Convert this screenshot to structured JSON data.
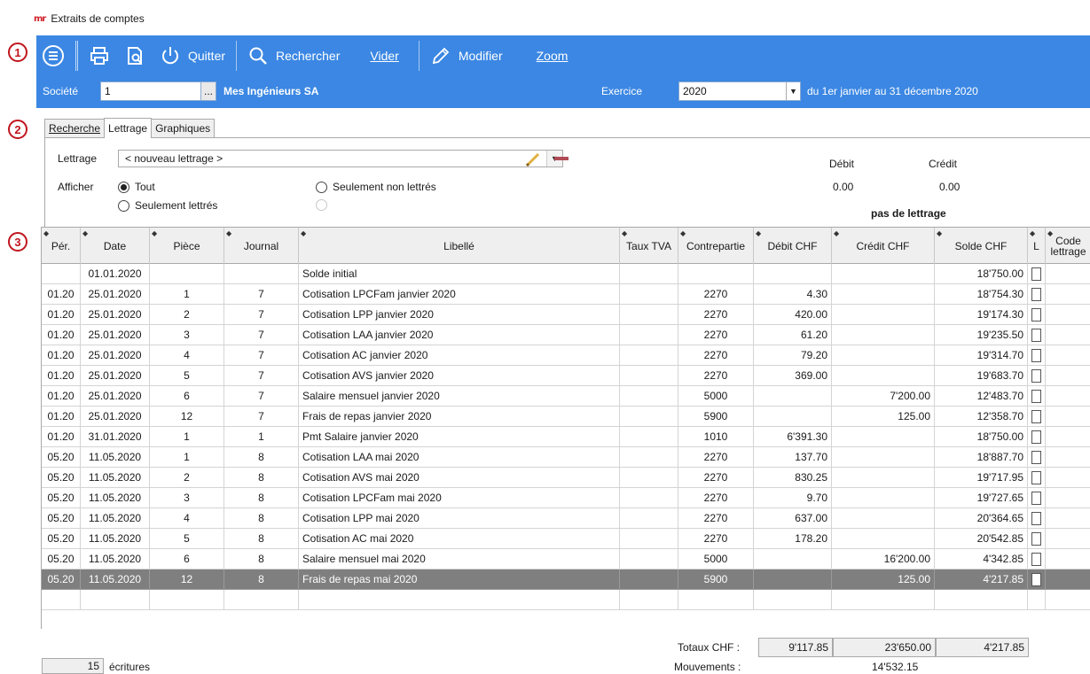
{
  "window": {
    "title": "Extraits de comptes",
    "logo": "mr"
  },
  "markers": [
    "1",
    "2",
    "3"
  ],
  "toolbar": {
    "quit_label": "Quitter",
    "search_label": "Rechercher",
    "clear_label": "Vider",
    "edit_label": "Modifier",
    "zoom_label": "Zoom",
    "company_label": "Société",
    "company_value": "1",
    "company_name": "Mes Ingénieurs SA",
    "fiscal_label": "Exercice",
    "fiscal_value": "2020",
    "period_text": "du 1er janvier au 31 décembre 2020",
    "browse_label": "..."
  },
  "tabs": [
    "Recherche",
    "Lettrage",
    "Graphiques"
  ],
  "lettrage": {
    "label": "Lettrage",
    "select_value": "< nouveau lettrage >",
    "show_label": "Afficher",
    "opt_all": "Tout",
    "opt_lettered": "Seulement lettrés",
    "opt_unlettered": "Seulement non lettrés",
    "debit_label": "Débit",
    "credit_label": "Crédit",
    "debit_value": "0.00",
    "credit_value": "0.00",
    "status": "pas de lettrage"
  },
  "columns": [
    "Pér.",
    "Date",
    "Pièce",
    "Journal",
    "Libellé",
    "Taux TVA",
    "Contrepartie",
    "Débit CHF",
    "Crédit CHF",
    "Solde CHF",
    "L",
    "Code lettrage"
  ],
  "rows": [
    [
      "",
      "01.01.2020",
      "",
      "",
      "Solde initial",
      "",
      "",
      "",
      "",
      "18'750.00"
    ],
    [
      "01.20",
      "25.01.2020",
      "1",
      "7",
      "Cotisation LPCFam janvier 2020",
      "",
      "2270",
      "4.30",
      "",
      "18'754.30"
    ],
    [
      "01.20",
      "25.01.2020",
      "2",
      "7",
      "Cotisation LPP janvier 2020",
      "",
      "2270",
      "420.00",
      "",
      "19'174.30"
    ],
    [
      "01.20",
      "25.01.2020",
      "3",
      "7",
      "Cotisation LAA janvier 2020",
      "",
      "2270",
      "61.20",
      "",
      "19'235.50"
    ],
    [
      "01.20",
      "25.01.2020",
      "4",
      "7",
      "Cotisation AC janvier 2020",
      "",
      "2270",
      "79.20",
      "",
      "19'314.70"
    ],
    [
      "01.20",
      "25.01.2020",
      "5",
      "7",
      "Cotisation AVS janvier 2020",
      "",
      "2270",
      "369.00",
      "",
      "19'683.70"
    ],
    [
      "01.20",
      "25.01.2020",
      "6",
      "7",
      "Salaire mensuel janvier 2020",
      "",
      "5000",
      "",
      "7'200.00",
      "12'483.70"
    ],
    [
      "01.20",
      "25.01.2020",
      "12",
      "7",
      "Frais de repas janvier 2020",
      "",
      "5900",
      "",
      "125.00",
      "12'358.70"
    ],
    [
      "01.20",
      "31.01.2020",
      "1",
      "1",
      "Pmt Salaire janvier 2020",
      "",
      "1010",
      "6'391.30",
      "",
      "18'750.00"
    ],
    [
      "05.20",
      "11.05.2020",
      "1",
      "8",
      "Cotisation LAA mai 2020",
      "",
      "2270",
      "137.70",
      "",
      "18'887.70"
    ],
    [
      "05.20",
      "11.05.2020",
      "2",
      "8",
      "Cotisation AVS mai 2020",
      "",
      "2270",
      "830.25",
      "",
      "19'717.95"
    ],
    [
      "05.20",
      "11.05.2020",
      "3",
      "8",
      "Cotisation LPCFam mai 2020",
      "",
      "2270",
      "9.70",
      "",
      "19'727.65"
    ],
    [
      "05.20",
      "11.05.2020",
      "4",
      "8",
      "Cotisation LPP mai 2020",
      "",
      "2270",
      "637.00",
      "",
      "20'364.65"
    ],
    [
      "05.20",
      "11.05.2020",
      "5",
      "8",
      "Cotisation AC mai 2020",
      "",
      "2270",
      "178.20",
      "",
      "20'542.85"
    ],
    [
      "05.20",
      "11.05.2020",
      "6",
      "8",
      "Salaire mensuel mai 2020",
      "",
      "5000",
      "",
      "16'200.00",
      "4'342.85"
    ],
    [
      "05.20",
      "11.05.2020",
      "12",
      "8",
      "Frais de repas mai 2020",
      "",
      "5900",
      "",
      "125.00",
      "4'217.85"
    ]
  ],
  "totals": {
    "label": "Totaux CHF :",
    "debit": "9'117.85",
    "credit": "23'650.00",
    "balance": "4'217.85",
    "movements_label": "Mouvements :",
    "movements": "14'532.15",
    "entries_count": "15",
    "entries_label": "écritures"
  }
}
